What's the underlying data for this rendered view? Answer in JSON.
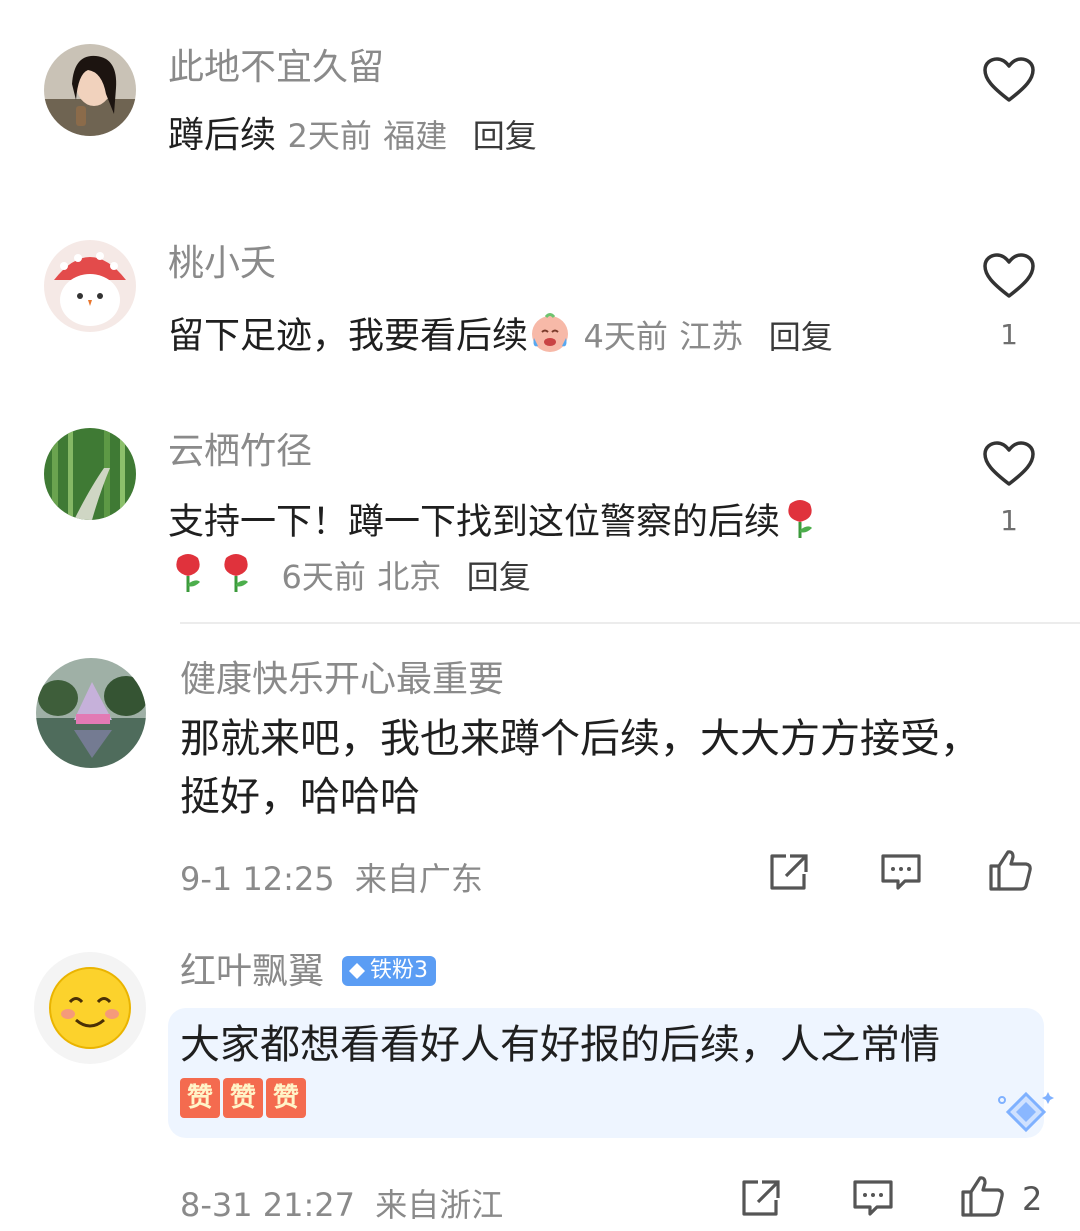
{
  "comments": [
    {
      "username": "此地不宜久留",
      "text": "蹲后续",
      "time": "2天前",
      "location": "福建",
      "reply_label": "回复",
      "likes": ""
    },
    {
      "username": "桃小夭",
      "text": "留下足迹，我要看后续",
      "time": "4天前",
      "location": "江苏",
      "reply_label": "回复",
      "likes": "1"
    },
    {
      "username": "云栖竹径",
      "text": "支持一下！蹲一下找到这位警察的后续",
      "time": "6天前",
      "location": "北京",
      "reply_label": "回复",
      "likes": "1"
    },
    {
      "username": "健康快乐开心最重要",
      "text": "那就来吧，我也来蹲个后续，大大方方接受，挺好，哈哈哈",
      "datetime": "9-1 12:25",
      "location_label": "来自广东",
      "likes": ""
    },
    {
      "username": "红叶飘翼",
      "badge": "铁粉3",
      "text": "大家都想看看好人有好报的后续，人之常情",
      "sticker_text": "赞",
      "datetime": "8-31 21:27",
      "location_label": "来自浙江",
      "likes": "2"
    }
  ],
  "icons": {
    "like_heart": "heart-outline-icon",
    "share": "share-icon",
    "comment": "comment-icon",
    "thumbs_up": "thumbs-up-icon"
  },
  "colors": {
    "username": "#8a8a8a",
    "text": "#1f1f1f",
    "badge": "#5b9df4",
    "highlight_bg": "#eef5ff"
  }
}
